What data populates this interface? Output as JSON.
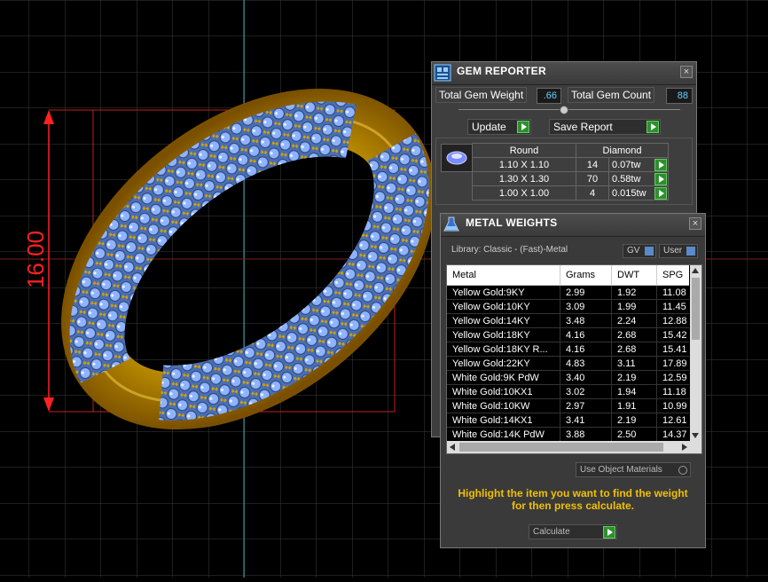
{
  "dimension": {
    "label": "16.00"
  },
  "gem_reporter": {
    "title": "GEM REPORTER",
    "close": "×",
    "total_weight_label": "Total Gem Weight",
    "total_weight_value": ".66",
    "total_count_label": "Total Gem Count",
    "total_count_value": "88",
    "update_label": "Update",
    "save_label": "Save Report",
    "table_header": {
      "shape": "Round",
      "material": "Diamond"
    },
    "rows": [
      {
        "size": "1.10 X 1.10",
        "count": "14",
        "tw": "0.07tw"
      },
      {
        "size": "1.30 X 1.30",
        "count": "70",
        "tw": "0.58tw"
      },
      {
        "size": "1.00 X 1.00",
        "count": "4",
        "tw": "0.015tw"
      }
    ]
  },
  "metal_weights": {
    "title": "METAL WEIGHTS",
    "close": "×",
    "library": "Library: Classic - (Fast)-Metal",
    "gv": "GV",
    "user": "User",
    "columns": [
      "Metal",
      "Grams",
      "DWT",
      "SPG"
    ],
    "rows": [
      {
        "metal": "Yellow Gold:9KY",
        "grams": "2.99",
        "dwt": "1.92",
        "spg": "11.08"
      },
      {
        "metal": "Yellow Gold:10KY",
        "grams": "3.09",
        "dwt": "1.99",
        "spg": "11.45"
      },
      {
        "metal": "Yellow Gold:14KY",
        "grams": "3.48",
        "dwt": "2.24",
        "spg": "12.88"
      },
      {
        "metal": "Yellow Gold:18KY",
        "grams": "4.16",
        "dwt": "2.68",
        "spg": "15.42"
      },
      {
        "metal": "Yellow Gold:18KY R...",
        "grams": "4.16",
        "dwt": "2.68",
        "spg": "15.41"
      },
      {
        "metal": "Yellow Gold:22KY",
        "grams": "4.83",
        "dwt": "3.11",
        "spg": "17.89"
      },
      {
        "metal": "White Gold:9K PdW",
        "grams": "3.40",
        "dwt": "2.19",
        "spg": "12.59"
      },
      {
        "metal": "White Gold:10KX1",
        "grams": "3.02",
        "dwt": "1.94",
        "spg": "11.18"
      },
      {
        "metal": "White Gold:10KW",
        "grams": "2.97",
        "dwt": "1.91",
        "spg": "10.99"
      },
      {
        "metal": "White Gold:14KX1",
        "grams": "3.41",
        "dwt": "2.19",
        "spg": "12.61"
      },
      {
        "metal": "White Gold:14K PdW",
        "grams": "3.88",
        "dwt": "2.50",
        "spg": "14.37"
      }
    ],
    "use_object_materials": "Use Object Materials",
    "instructions": "Highlight the item you want to find the weight for then press calculate.",
    "calculate_label": "Calculate"
  },
  "colors": {
    "accent": "#f0c000",
    "grid": "#3a3a3a",
    "dimension": "#ff2020",
    "gem": "#8fb4ff",
    "gold": "#e8b800"
  }
}
